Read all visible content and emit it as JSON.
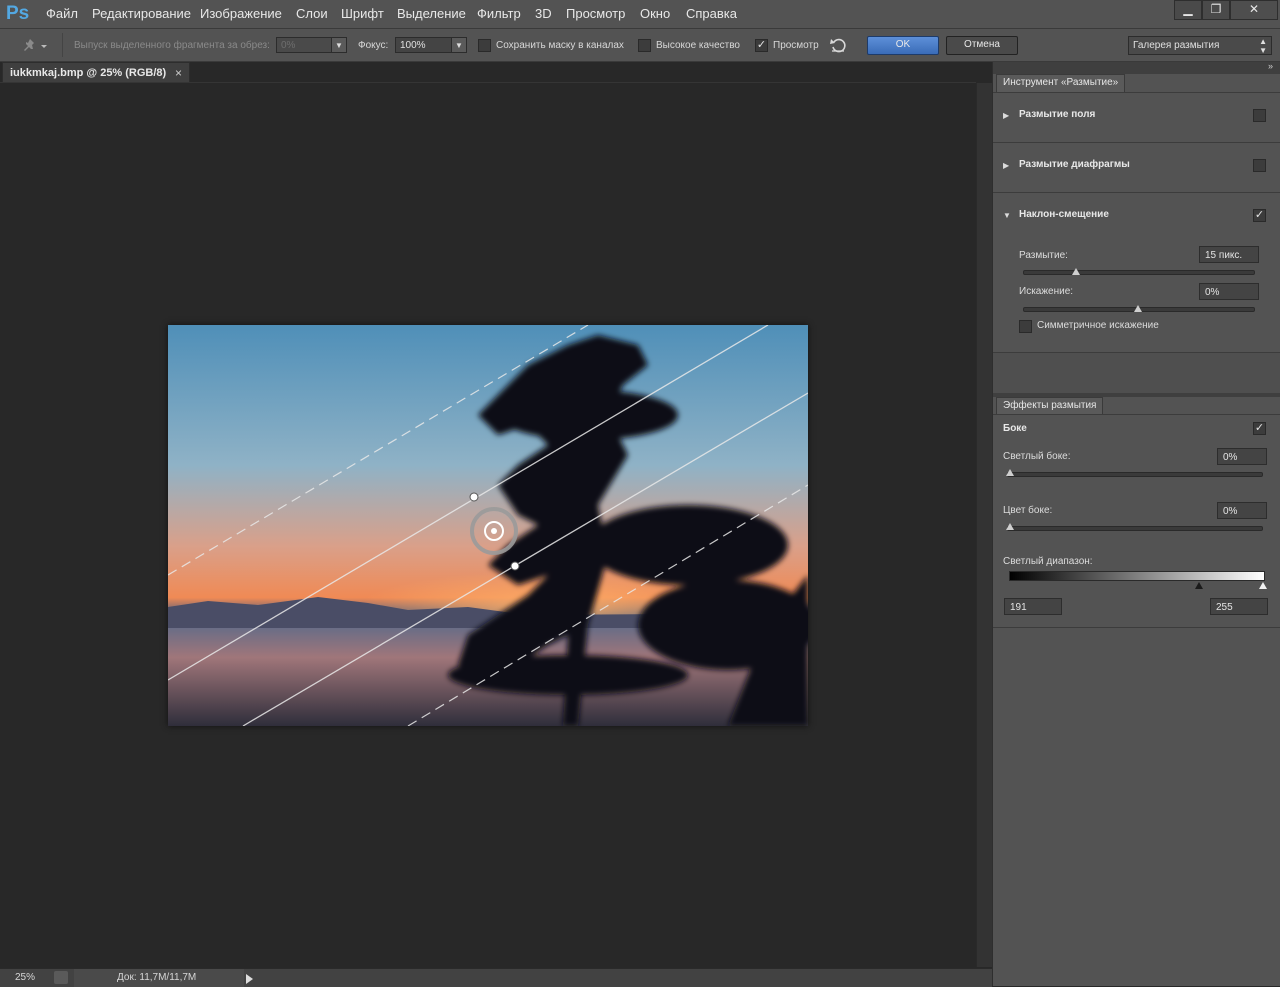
{
  "app": {
    "logo": "Ps",
    "menu": [
      "Файл",
      "Редактирование",
      "Изображение",
      "Слои",
      "Шрифт",
      "Выделение",
      "Фильтр",
      "3D",
      "Просмотр",
      "Окно",
      "Справка"
    ],
    "window_controls": {
      "minimize": "▁",
      "restore": "❐",
      "close": "✕"
    }
  },
  "options": {
    "output_label": "Выпуск выделенного фрагмента за обрез:",
    "output_value": "0%",
    "focus_label": "Фокус:",
    "focus_value": "100%",
    "save_mask_label": "Сохранить маску в каналах",
    "high_quality_label": "Высокое качество",
    "preview_label": "Просмотр",
    "preview_checked": true,
    "ok_label": "OK",
    "cancel_label": "Отмена",
    "workspace_value": "Галерея размытия"
  },
  "document": {
    "tab_title": "iukkmkaj.bmp @ 25% (RGB/8)",
    "close": "×"
  },
  "status": {
    "zoom": "25%",
    "doc_size": "Док: 11,7M/11,7M"
  },
  "blur_tools": {
    "tab_title": "Инструмент «Размытие»",
    "field_blur": {
      "title": "Размытие поля",
      "checked": false
    },
    "iris_blur": {
      "title": "Размытие диафрагмы",
      "checked": false
    },
    "tilt_shift": {
      "title": "Наклон-смещение",
      "checked": true,
      "blur_label": "Размытие:",
      "blur_value": "15 пикс.",
      "blur_level": 0.23,
      "distortion_label": "Искажение:",
      "distortion_value": "0%",
      "distortion_level": 0.5,
      "symmetric_label": "Симметричное искажение"
    }
  },
  "blur_effects": {
    "tab_title": "Эффекты размытия",
    "bokeh_label": "Боке",
    "bokeh_checked": true,
    "light_bokeh_label": "Светлый боке:",
    "light_bokeh_value": "0%",
    "bokeh_color_label": "Цвет боке:",
    "bokeh_color_value": "0%",
    "light_range_label": "Светлый диапазон:",
    "light_range_min": "191",
    "light_range_max": "255"
  }
}
